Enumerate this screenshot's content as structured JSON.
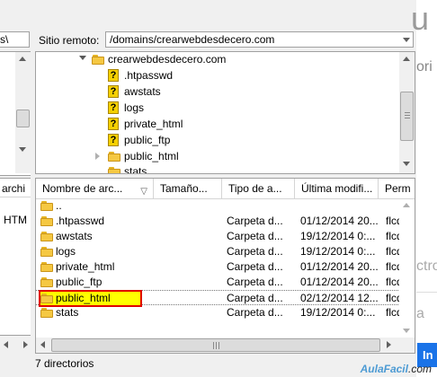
{
  "left_pane": {
    "combo_value": "s\\",
    "column_header": "archi",
    "row_type": "HTM"
  },
  "remote": {
    "site_label": "Sitio remoto:",
    "path": "/domains/crearwebdesdecero.com",
    "tree": [
      {
        "label": "crearwebdesdecero.com",
        "icon": "folder-icon",
        "expanded": true
      },
      {
        "label": ".htpasswd",
        "icon": "unknown-icon"
      },
      {
        "label": "awstats",
        "icon": "unknown-icon"
      },
      {
        "label": "logs",
        "icon": "unknown-icon"
      },
      {
        "label": "private_html",
        "icon": "unknown-icon"
      },
      {
        "label": "public_ftp",
        "icon": "unknown-icon"
      },
      {
        "label": "public_html",
        "icon": "folder-icon",
        "expanded": false
      },
      {
        "label": "stats",
        "icon": "folder-icon"
      }
    ]
  },
  "file_list": {
    "columns": [
      "Nombre de arc...",
      "Tamaño...",
      "Tipo de a...",
      "Última modifi...",
      "Perm"
    ],
    "sort_indicator": "▽",
    "rows": [
      {
        "name": "..",
        "size": "",
        "type": "",
        "modified": "",
        "perm": ""
      },
      {
        "name": ".htpasswd",
        "size": "",
        "type": "Carpeta d...",
        "modified": "01/12/2014 20...",
        "perm": "flcdm"
      },
      {
        "name": "awstats",
        "size": "",
        "type": "Carpeta d...",
        "modified": "19/12/2014 0:...",
        "perm": "flcdm"
      },
      {
        "name": "logs",
        "size": "",
        "type": "Carpeta d...",
        "modified": "19/12/2014 0:...",
        "perm": "flcdm"
      },
      {
        "name": "private_html",
        "size": "",
        "type": "Carpeta d...",
        "modified": "01/12/2014 20...",
        "perm": "flcdm"
      },
      {
        "name": "public_ftp",
        "size": "",
        "type": "Carpeta d...",
        "modified": "01/12/2014 20...",
        "perm": "flcdm"
      },
      {
        "name": "public_html",
        "size": "",
        "type": "Carpeta d...",
        "modified": "02/12/2014 12...",
        "perm": "flcdm",
        "selected": true
      },
      {
        "name": "stats",
        "size": "",
        "type": "Carpeta d...",
        "modified": "19/12/2014 0:...",
        "perm": "flcdm"
      }
    ]
  },
  "status": "7 directorios",
  "right_pane": {
    "text_top": "u",
    "text_mid": "ori",
    "text_low": "ctro",
    "text_low2": "a",
    "button_label": "In"
  },
  "watermark": {
    "brand": "AulaFacil",
    "suffix": ".com"
  },
  "colors": {
    "highlight_fill": "#ffff00",
    "highlight_border": "#e00000",
    "folder": "#f5c842",
    "unknown": "#f5d000",
    "accent_button": "#1a73e8"
  }
}
